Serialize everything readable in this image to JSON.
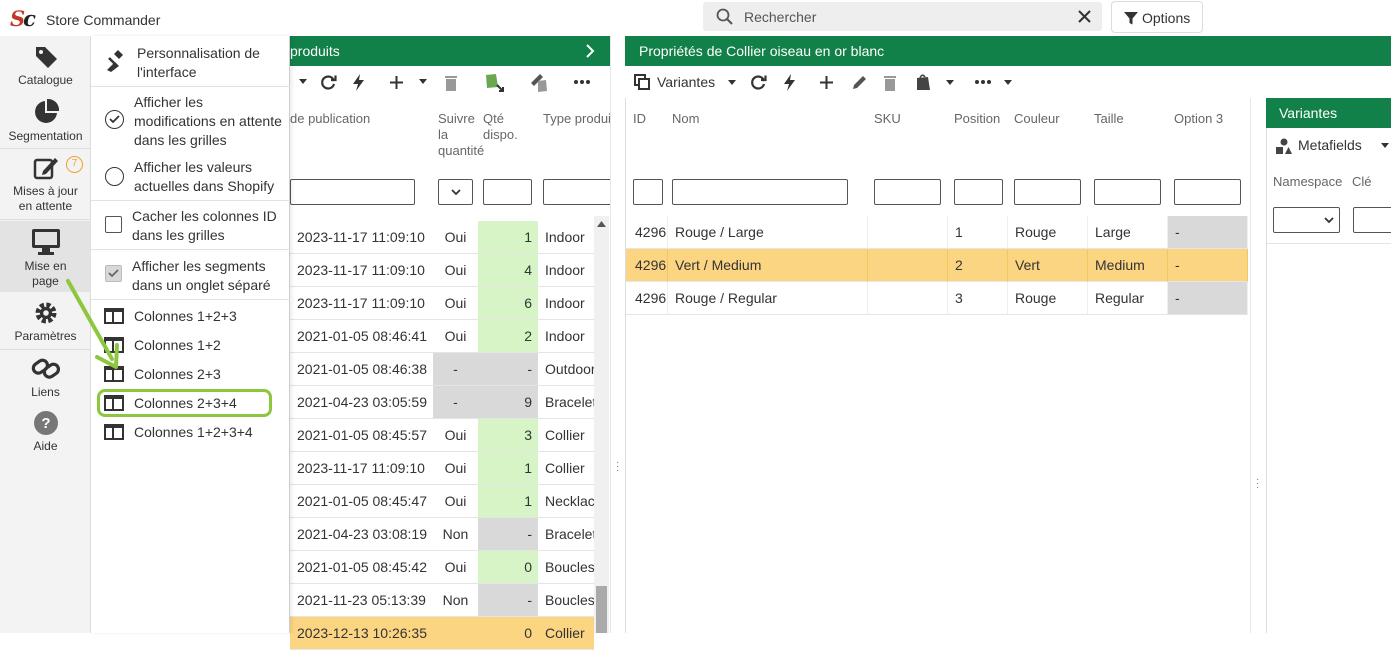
{
  "app": {
    "title": "Store Commander",
    "logo": "Sc"
  },
  "search": {
    "placeholder": "Rechercher"
  },
  "options_label": "Options",
  "sidebar": {
    "items": [
      {
        "label": "Catalogue"
      },
      {
        "label": "Segmentation"
      },
      {
        "label": "Mises à jour en attente",
        "badge": "7"
      },
      {
        "label": "Mise en page"
      },
      {
        "label": "Paramètres"
      },
      {
        "label": "Liens"
      },
      {
        "label": "Aide"
      }
    ]
  },
  "menu": {
    "customize": "Personnalisation de l'interface",
    "show_pending": "Afficher les modifications en attente dans les grilles",
    "show_current": "Afficher les valeurs actuelles dans Shopify",
    "hide_id": "Cacher les colonnes ID dans les grilles",
    "show_segments": "Afficher les segments dans un onglet séparé",
    "layouts": [
      "Colonnes 1+2+3",
      "Colonnes 1+2",
      "Colonnes 2+3",
      "Colonnes 2+3+4",
      "Colonnes 1+2+3+4"
    ]
  },
  "products": {
    "title": "produits",
    "columns": [
      "de publication",
      "Suivre la quantité",
      "Qté dispo.",
      "Type produit"
    ],
    "rows": [
      {
        "date": "2023-11-17 11:09:10",
        "track": "Oui",
        "qty": "1",
        "type": "Indoor"
      },
      {
        "date": "2023-11-17 11:09:10",
        "track": "Oui",
        "qty": "4",
        "type": "Indoor"
      },
      {
        "date": "2023-11-17 11:09:10",
        "track": "Oui",
        "qty": "6",
        "type": "Indoor"
      },
      {
        "date": "2021-01-05 08:46:41",
        "track": "Oui",
        "qty": "2",
        "type": "Indoor"
      },
      {
        "date": "2021-01-05 08:46:38",
        "track": "-",
        "qty": "-",
        "type": "Outdoor"
      },
      {
        "date": "2021-04-23 03:05:59",
        "track": "-",
        "qty": "9",
        "type": "Bracelet"
      },
      {
        "date": "2021-01-05 08:45:57",
        "track": "Oui",
        "qty": "3",
        "type": "Collier"
      },
      {
        "date": "2023-11-17 11:09:10",
        "track": "Oui",
        "qty": "1",
        "type": "Collier"
      },
      {
        "date": "2021-01-05 08:45:47",
        "track": "Oui",
        "qty": "1",
        "type": "Necklace"
      },
      {
        "date": "2021-04-23 03:08:19",
        "track": "Non",
        "qty": "-",
        "type": "Bracelet"
      },
      {
        "date": "2021-01-05 08:45:42",
        "track": "Oui",
        "qty": "0",
        "type": "Boucles"
      },
      {
        "date": "2021-11-23 05:13:39",
        "track": "Non",
        "qty": "-",
        "type": "Boucles"
      },
      {
        "date": "2023-12-13 10:26:35",
        "track": "",
        "qty": "0",
        "type": "Collier"
      }
    ]
  },
  "properties": {
    "title": "Propriétés de Collier oiseau en or blanc",
    "variants_label": "Variantes",
    "columns": [
      "ID",
      "Nom",
      "SKU",
      "Position",
      "Couleur",
      "Taille",
      "Option 3"
    ],
    "rows": [
      {
        "id": "4296",
        "name": "Rouge / Large",
        "sku": "",
        "pos": "1",
        "color": "Rouge",
        "size": "Large",
        "opt3": "-"
      },
      {
        "id": "4296",
        "name": "Vert / Medium",
        "sku": "",
        "pos": "2",
        "color": "Vert",
        "size": "Medium",
        "opt3": "-"
      },
      {
        "id": "4296",
        "name": "Rouge / Regular",
        "sku": "",
        "pos": "3",
        "color": "Rouge",
        "size": "Regular",
        "opt3": "-"
      }
    ]
  },
  "variants_panel": {
    "title": "Variantes",
    "metafields_label": "Metafields",
    "columns": [
      "Namespace",
      "Clé"
    ]
  },
  "colors": {
    "accent": "#128049",
    "highlight": "#8dc63f",
    "selected_row": "#fcd582",
    "green_cell": "#d7f4c6"
  }
}
